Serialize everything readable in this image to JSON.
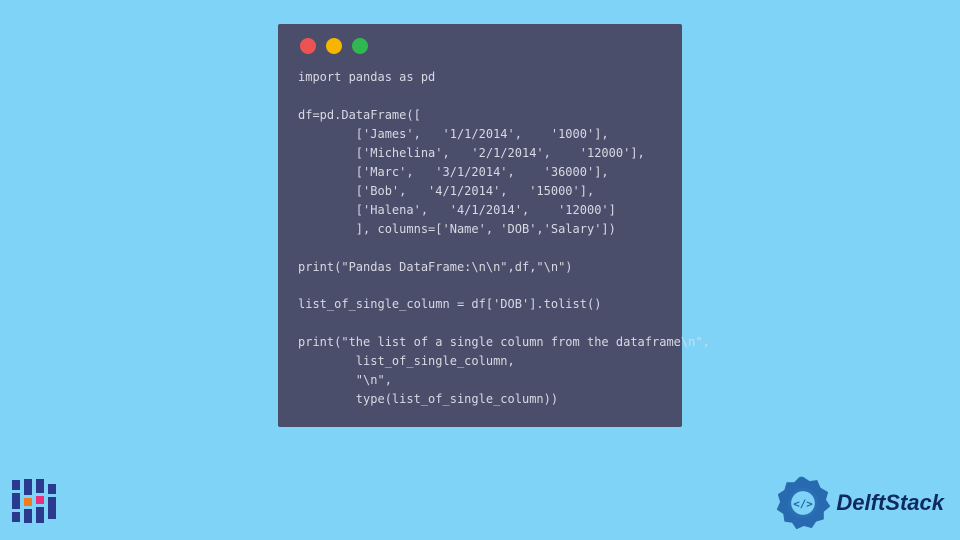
{
  "code": {
    "lines": [
      "import pandas as pd",
      "",
      "df=pd.DataFrame([",
      "        ['James',   '1/1/2014',    '1000'],",
      "        ['Michelina',   '2/1/2014',    '12000'],",
      "        ['Marc',   '3/1/2014',    '36000'],",
      "        ['Bob',   '4/1/2014',   '15000'],",
      "        ['Halena',   '4/1/2014',    '12000']",
      "        ], columns=['Name', 'DOB','Salary'])",
      "",
      "print(\"Pandas DataFrame:\\n\\n\",df,\"\\n\")",
      "",
      "list_of_single_column = df['DOB'].tolist()",
      "",
      "print(\"the list of a single column from the dataframe\\n\",",
      "        list_of_single_column,",
      "        \"\\n\",",
      "        type(list_of_single_column))"
    ]
  },
  "brand": {
    "name": "DelftStack"
  }
}
